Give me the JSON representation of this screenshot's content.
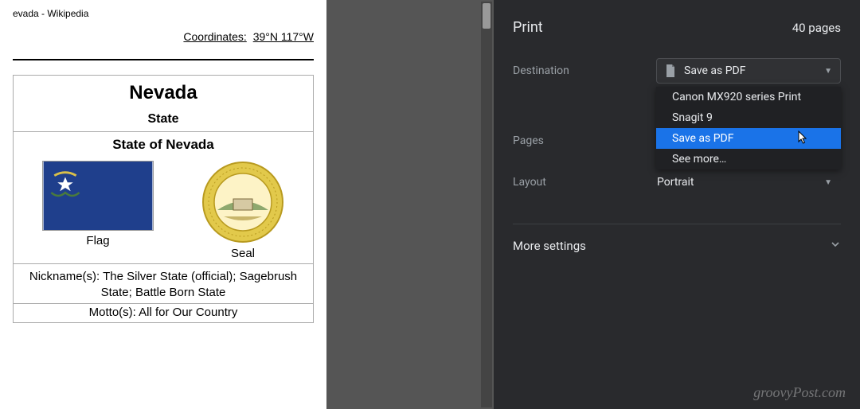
{
  "preview": {
    "page_title_text": "evada - Wikipedia",
    "coordinates_label": "Coordinates:",
    "coordinates_value": "39°N 117°W",
    "infobox": {
      "title": "Nevada",
      "subtitle": "State",
      "fullname": "State of Nevada",
      "flag_label": "Flag",
      "seal_label": "Seal",
      "nicknames": "Nickname(s): The Silver State (official); Sagebrush State; Battle Born State",
      "motto": "Motto(s): All for Our Country"
    }
  },
  "panel": {
    "title": "Print",
    "page_count": "40 pages",
    "destination": {
      "label": "Destination",
      "selected": "Save as PDF",
      "options": {
        "opt0": "Canon MX920 series Print",
        "opt1": "Snagit 9",
        "opt2": "Save as PDF",
        "opt3": "See more…"
      }
    },
    "pages": {
      "label": "Pages"
    },
    "layout": {
      "label": "Layout",
      "selected": "Portrait"
    },
    "more_settings": "More settings"
  },
  "watermark": "groovyPost.com"
}
